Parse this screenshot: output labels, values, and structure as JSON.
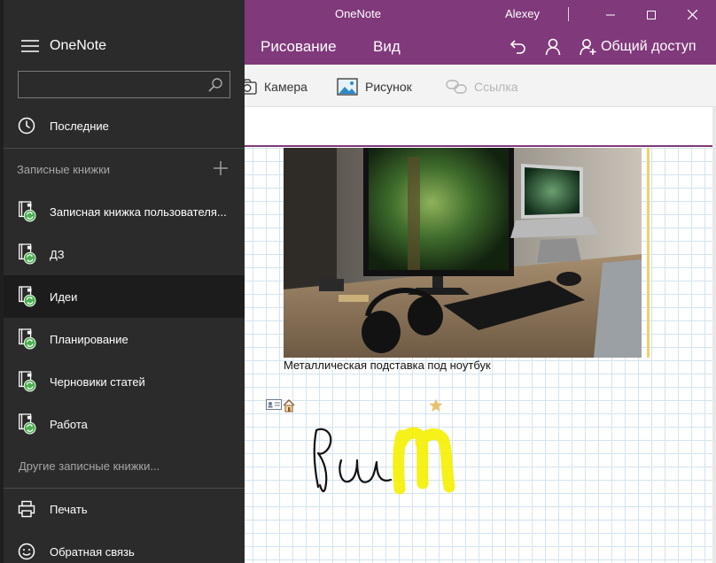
{
  "window": {
    "app_title": "OneNote",
    "user": "Alexey",
    "buttons": [
      "minimize",
      "maximize",
      "close"
    ]
  },
  "ribbon_tabs": {
    "draw": "Рисование",
    "view": "Вид",
    "share": "Общий доступ"
  },
  "ribbon": {
    "camera": "Камера",
    "picture": "Рисунок",
    "link": "Ссылка"
  },
  "page": {
    "caption": "Металлическая подставка под ноутбук",
    "ink_text": "Ru",
    "ink_highlight": "m"
  },
  "nav": {
    "title": "OneNote",
    "search_placeholder": "",
    "recent": "Последние",
    "notebooks_header": "Записные книжки",
    "notebooks": [
      {
        "label": "Записная книжка пользователя...",
        "selected": false
      },
      {
        "label": "ДЗ",
        "selected": false
      },
      {
        "label": "Идеи",
        "selected": true
      },
      {
        "label": "Планирование",
        "selected": false
      },
      {
        "label": "Черновики статей",
        "selected": false
      },
      {
        "label": "Работа",
        "selected": false
      }
    ],
    "other_notebooks": "Другие записные книжки...",
    "print": "Печать",
    "feedback": "Обратная связь"
  },
  "colors": {
    "accent": "#80397b",
    "nav_bg": "#2b2b2b",
    "nav_selected": "#1c1c1c",
    "sync_badge": "#4caf50",
    "highlighter": "#f5f000",
    "grid": "#d3e4ef"
  },
  "icons": [
    "hamburger-icon",
    "search-icon",
    "clock-icon",
    "plus-icon",
    "notebook-icon",
    "sync-badge-icon",
    "printer-icon",
    "smiley-icon",
    "undo-icon",
    "person-icon",
    "share-person-icon",
    "camera-icon",
    "picture-icon",
    "link-icon",
    "contact-tag-icon",
    "home-tag-icon",
    "star-icon"
  ]
}
